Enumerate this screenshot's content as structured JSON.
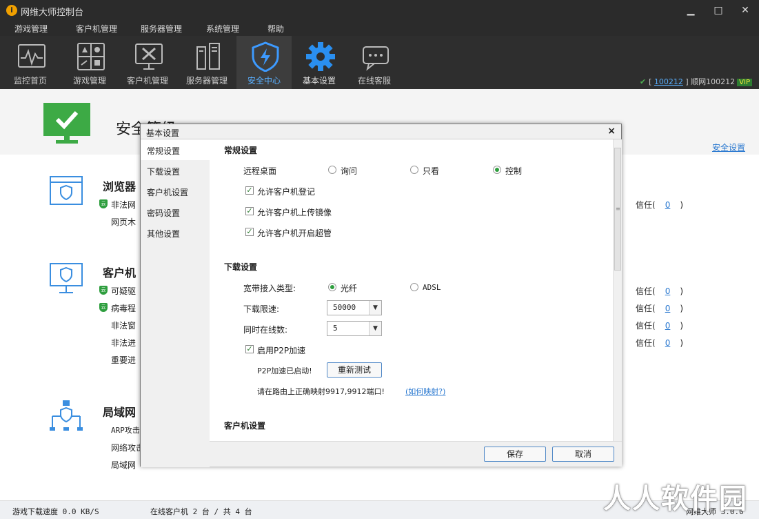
{
  "window": {
    "title": "网维大师控制台"
  },
  "menu": [
    "游戏管理",
    "客户机管理",
    "服务器管理",
    "系统管理",
    "帮助"
  ],
  "toolbar": [
    {
      "label": "监控首页",
      "icon": "monitor-chart-icon"
    },
    {
      "label": "游戏管理",
      "icon": "game-grid-icon"
    },
    {
      "label": "客户机管理",
      "icon": "client-tools-icon"
    },
    {
      "label": "服务器管理",
      "icon": "server-icon"
    },
    {
      "label": "安全中心",
      "icon": "shield-icon",
      "active": true
    },
    {
      "label": "基本设置",
      "icon": "gear-icon"
    },
    {
      "label": "在线客服",
      "icon": "chat-icon"
    }
  ],
  "user": {
    "bracket_open": "[",
    "id": "100212",
    "bracket_close": "]",
    "name": "顺网100212",
    "vip": "VIP"
  },
  "page": {
    "hero_title": "安全等级",
    "security_link": "安全设置",
    "sections": [
      {
        "name": "浏览器",
        "rows": [
          "非法网",
          "网页木"
        ]
      },
      {
        "name": "客户机",
        "rows": [
          "可疑驱",
          "病毒程",
          "非法窗",
          "非法进",
          "重要进"
        ]
      },
      {
        "name": "局域网",
        "rows": [
          "ARP攻击",
          "网络攻击",
          "局域网"
        ]
      }
    ],
    "badge_text": "云",
    "trust": {
      "label": "信任(",
      "value": "0",
      "close": ")"
    }
  },
  "status": {
    "download_speed": "游戏下载速度 0.0 KB/S",
    "clients": "在线客户机 2 台 / 共 4 台",
    "right": "网维大师 3.0.0"
  },
  "watermark": "人人软件园",
  "dialog": {
    "title": "基本设置",
    "close": "×",
    "nav": [
      "常规设置",
      "下载设置",
      "客户机设置",
      "密码设置",
      "其他设置"
    ],
    "general": {
      "heading": "常规设置",
      "remote_desktop_label": "远程桌面",
      "remote_options": [
        "询问",
        "只看",
        "控制"
      ],
      "remote_selected": "控制",
      "checks": [
        "允许客户机登记",
        "允许客户机上传镜像",
        "允许客户机开启超管"
      ]
    },
    "download": {
      "heading": "下载设置",
      "broadband_label": "宽带接入类型:",
      "broadband_options": [
        "光纤",
        "ADSL"
      ],
      "broadband_selected": "光纤",
      "speed_label": "下载限速:",
      "speed_value": "50000",
      "concurrent_label": "同时在线数:",
      "concurrent_value": "5",
      "p2p_label": "启用P2P加速",
      "p2p_status": "P2P加速已启动!",
      "retest_button": "重新测试",
      "port_note": "请在路由上正确映射9917,9912端口!",
      "port_link": "(如何映射?)"
    },
    "client_heading": "客户机设置",
    "save_button": "保存",
    "cancel_button": "取消"
  }
}
